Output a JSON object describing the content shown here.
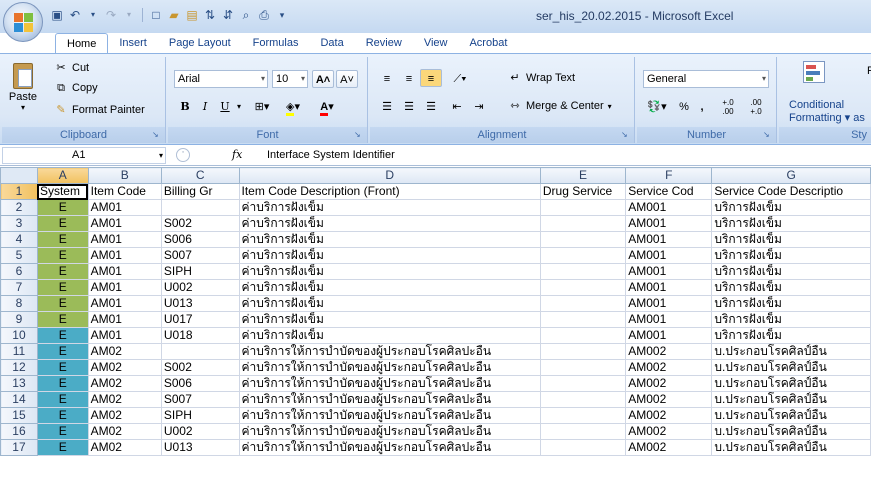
{
  "window": {
    "title": "ser_his_20.02.2015 - Microsoft Excel"
  },
  "tabs": [
    "Home",
    "Insert",
    "Page Layout",
    "Formulas",
    "Data",
    "Review",
    "View",
    "Acrobat"
  ],
  "ribbon": {
    "clipboard": {
      "label": "Clipboard",
      "paste": "Paste",
      "cut": "Cut",
      "copy": "Copy",
      "format_painter": "Format Painter"
    },
    "font": {
      "label": "Font",
      "name": "Arial",
      "size": "10",
      "bold": "B",
      "italic": "I",
      "underline": "U"
    },
    "alignment": {
      "label": "Alignment",
      "wrap_text": "Wrap Text",
      "merge_center": "Merge & Center"
    },
    "number": {
      "label": "Number",
      "format": "General",
      "percent": "%",
      "comma": ",",
      "inc_dec": "+.0 .00",
      "dec_dec": ".00 +.0"
    },
    "styles": {
      "label": "Sty",
      "conditional": "Conditional",
      "formatting": "Formatting",
      "f_trunc": "F",
      "as_trunc": "as"
    }
  },
  "formula_bar": {
    "name_box": "A1",
    "fx": "fx",
    "value": "Interface System Identifier"
  },
  "columns": [
    "A",
    "B",
    "C",
    "D",
    "E",
    "F",
    "G"
  ],
  "rows": [
    {
      "n": "1",
      "cells": [
        "System",
        "Item Code",
        "Billing Gr",
        "Item Code Description (Front)",
        "Drug Service",
        "Service Cod",
        "Service Code Descriptio"
      ]
    },
    {
      "n": "2",
      "cells": [
        "E",
        "AM01",
        "",
        "ค่าบริการฝังเข็ม",
        "",
        "AM001",
        "บริการฝังเข็ม"
      ]
    },
    {
      "n": "3",
      "cells": [
        "E",
        "AM01",
        "S002",
        "ค่าบริการฝังเข็ม",
        "",
        "AM001",
        "บริการฝังเข็ม"
      ]
    },
    {
      "n": "4",
      "cells": [
        "E",
        "AM01",
        "S006",
        "ค่าบริการฝังเข็ม",
        "",
        "AM001",
        "บริการฝังเข็ม"
      ]
    },
    {
      "n": "5",
      "cells": [
        "E",
        "AM01",
        "S007",
        "ค่าบริการฝังเข็ม",
        "",
        "AM001",
        "บริการฝังเข็ม"
      ]
    },
    {
      "n": "6",
      "cells": [
        "E",
        "AM01",
        "SIPH",
        "ค่าบริการฝังเข็ม",
        "",
        "AM001",
        "บริการฝังเข็ม"
      ]
    },
    {
      "n": "7",
      "cells": [
        "E",
        "AM01",
        "U002",
        "ค่าบริการฝังเข็ม",
        "",
        "AM001",
        "บริการฝังเข็ม"
      ]
    },
    {
      "n": "8",
      "cells": [
        "E",
        "AM01",
        "U013",
        "ค่าบริการฝังเข็ม",
        "",
        "AM001",
        "บริการฝังเข็ม"
      ]
    },
    {
      "n": "9",
      "cells": [
        "E",
        "AM01",
        "U017",
        "ค่าบริการฝังเข็ม",
        "",
        "AM001",
        "บริการฝังเข็ม"
      ]
    },
    {
      "n": "10",
      "cells": [
        "E",
        "AM01",
        "U018",
        "ค่าบริการฝังเข็ม",
        "",
        "AM001",
        "บริการฝังเข็ม"
      ]
    },
    {
      "n": "11",
      "cells": [
        "E",
        "AM02",
        "",
        "ค่าบริการให้การบำบัดของผู้ประกอบโรคศิลปะอื่น",
        "",
        "AM002",
        "บ.ประกอบโรคศิลป์อื่น"
      ]
    },
    {
      "n": "12",
      "cells": [
        "E",
        "AM02",
        "S002",
        "ค่าบริการให้การบำบัดของผู้ประกอบโรคศิลปะอื่น",
        "",
        "AM002",
        "บ.ประกอบโรคศิลป์อื่น"
      ]
    },
    {
      "n": "13",
      "cells": [
        "E",
        "AM02",
        "S006",
        "ค่าบริการให้การบำบัดของผู้ประกอบโรคศิลปะอื่น",
        "",
        "AM002",
        "บ.ประกอบโรคศิลป์อื่น"
      ]
    },
    {
      "n": "14",
      "cells": [
        "E",
        "AM02",
        "S007",
        "ค่าบริการให้การบำบัดของผู้ประกอบโรคศิลปะอื่น",
        "",
        "AM002",
        "บ.ประกอบโรคศิลป์อื่น"
      ]
    },
    {
      "n": "15",
      "cells": [
        "E",
        "AM02",
        "SIPH",
        "ค่าบริการให้การบำบัดของผู้ประกอบโรคศิลปะอื่น",
        "",
        "AM002",
        "บ.ประกอบโรคศิลป์อื่น"
      ]
    },
    {
      "n": "16",
      "cells": [
        "E",
        "AM02",
        "U002",
        "ค่าบริการให้การบำบัดของผู้ประกอบโรคศิลปะอื่น",
        "",
        "AM002",
        "บ.ประกอบโรคศิลป์อื่น"
      ]
    },
    {
      "n": "17",
      "cells": [
        "E",
        "AM02",
        "U013",
        "ค่าบริการให้การบำบัดของผู้ประกอบโรคศิลปะอื่น",
        "",
        "AM002",
        "บ.ประกอบโรคศิลป์อื่น"
      ]
    }
  ],
  "colors": {
    "green_fill": "#9bbb59",
    "blue_fill": "#4bacc6"
  },
  "fill_rows": {
    "green": [
      "2",
      "3",
      "4",
      "5",
      "6",
      "7",
      "8",
      "9"
    ],
    "blue": [
      "10",
      "11",
      "12",
      "13",
      "14",
      "15",
      "16",
      "17"
    ]
  }
}
